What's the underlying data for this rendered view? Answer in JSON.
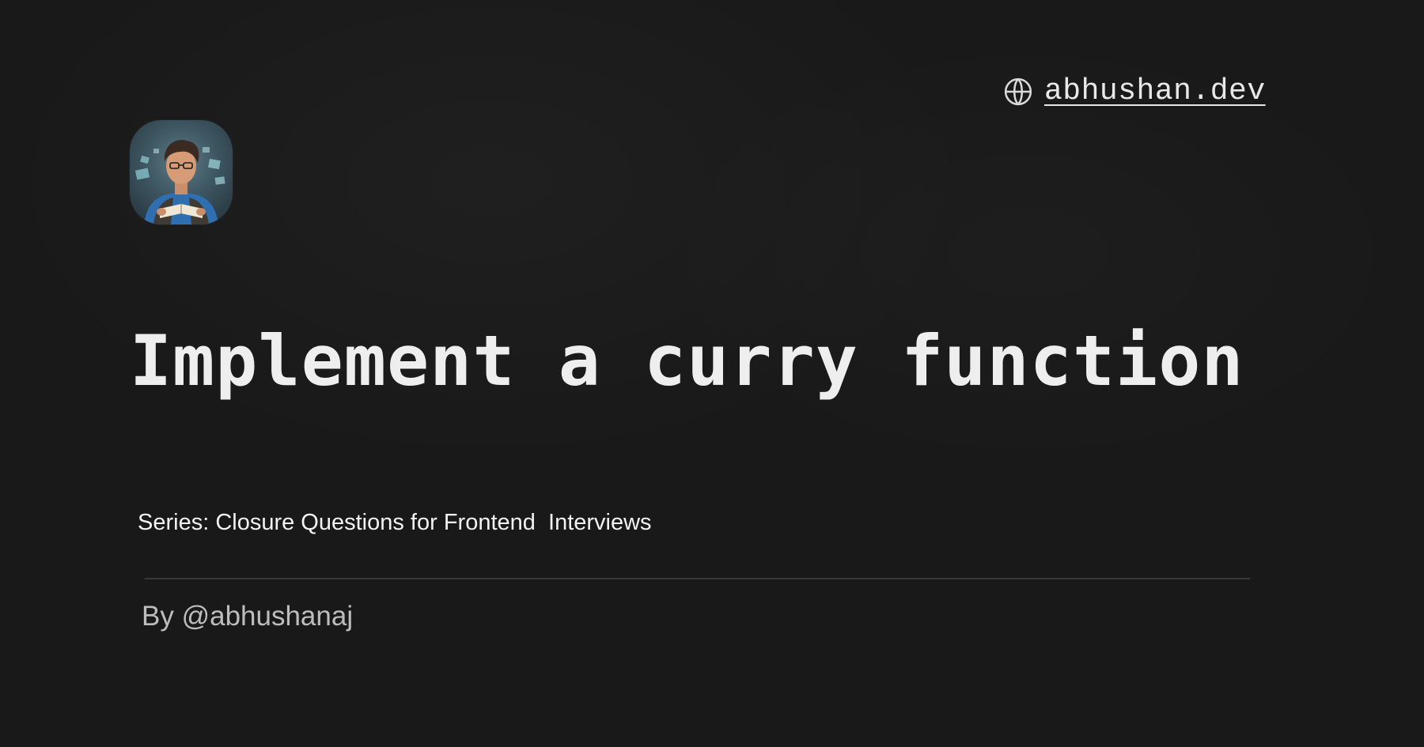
{
  "header": {
    "site_link_text": "abhushan.dev",
    "site_icon": "globe-icon"
  },
  "avatar": {
    "alt": "Author avatar"
  },
  "main": {
    "title": "Implement a curry function",
    "series": "Series: Closure Questions for Frontend  Interviews",
    "byline": "By @abhushanaj"
  },
  "colors": {
    "background": "#191919",
    "title": "#eeeeee",
    "series": "#f2f2f2",
    "byline": "#bdbdbd",
    "divider": "#3a3a3a"
  }
}
